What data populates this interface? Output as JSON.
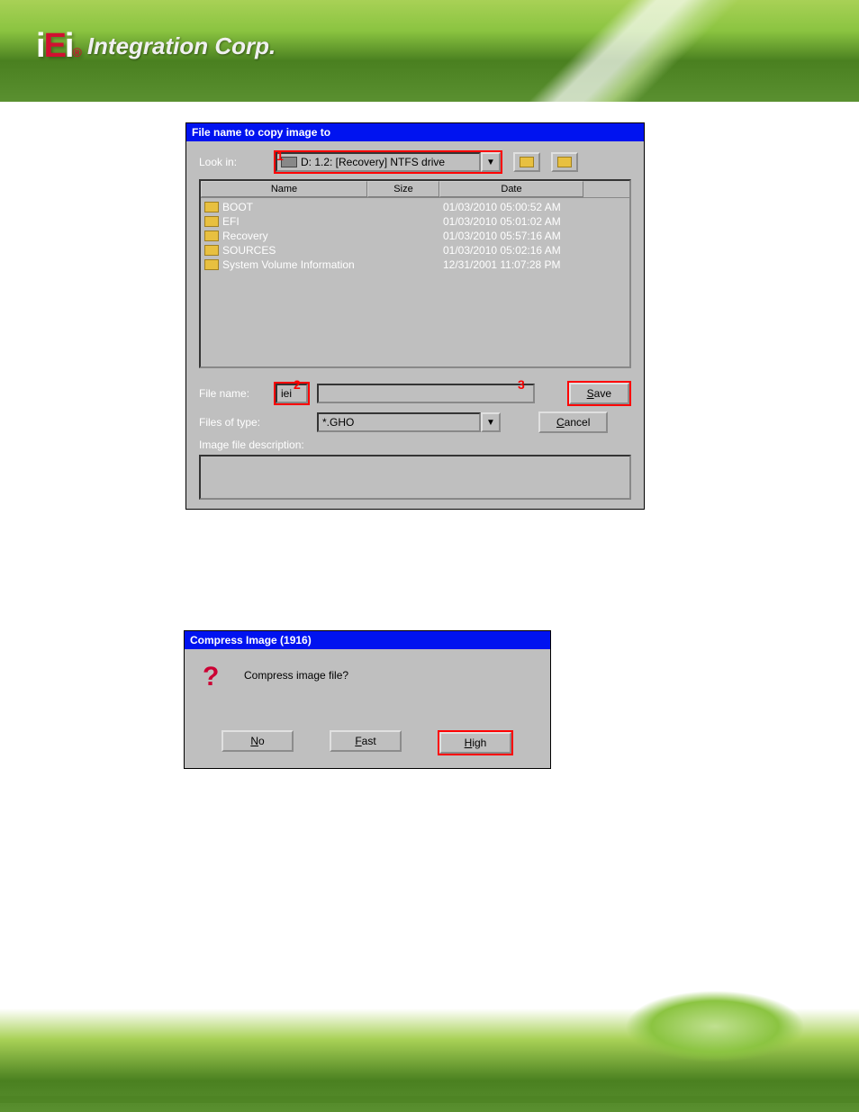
{
  "logo": {
    "text": "Integration Corp."
  },
  "dialog1": {
    "title": "File name to copy image to",
    "look_in_label": "Look in:",
    "look_in_value": "D: 1.2: [Recovery] NTFS drive",
    "headers": {
      "name": "Name",
      "size": "Size",
      "date": "Date"
    },
    "rows": [
      {
        "name": "BOOT",
        "date": "01/03/2010 05:00:52 AM"
      },
      {
        "name": "EFI",
        "date": "01/03/2010 05:01:02 AM"
      },
      {
        "name": "Recovery",
        "date": "01/03/2010 05:57:16 AM"
      },
      {
        "name": "SOURCES",
        "date": "01/03/2010 05:02:16 AM"
      },
      {
        "name": "System Volume Information",
        "date": "12/31/2001 11:07:28 PM"
      }
    ],
    "file_name_label": "File name:",
    "file_name_value": "iei",
    "files_type_label": "Files of type:",
    "files_type_value": "*.GHO",
    "description_label": "Image file description:",
    "save_btn": "Save",
    "cancel_btn": "Cancel",
    "callouts": {
      "c1": "1",
      "c2": "2",
      "c3": "3"
    }
  },
  "dialog2": {
    "title": "Compress Image (1916)",
    "question": "Compress image file?",
    "no_btn": "No",
    "fast_btn": "Fast",
    "high_btn": "High"
  }
}
